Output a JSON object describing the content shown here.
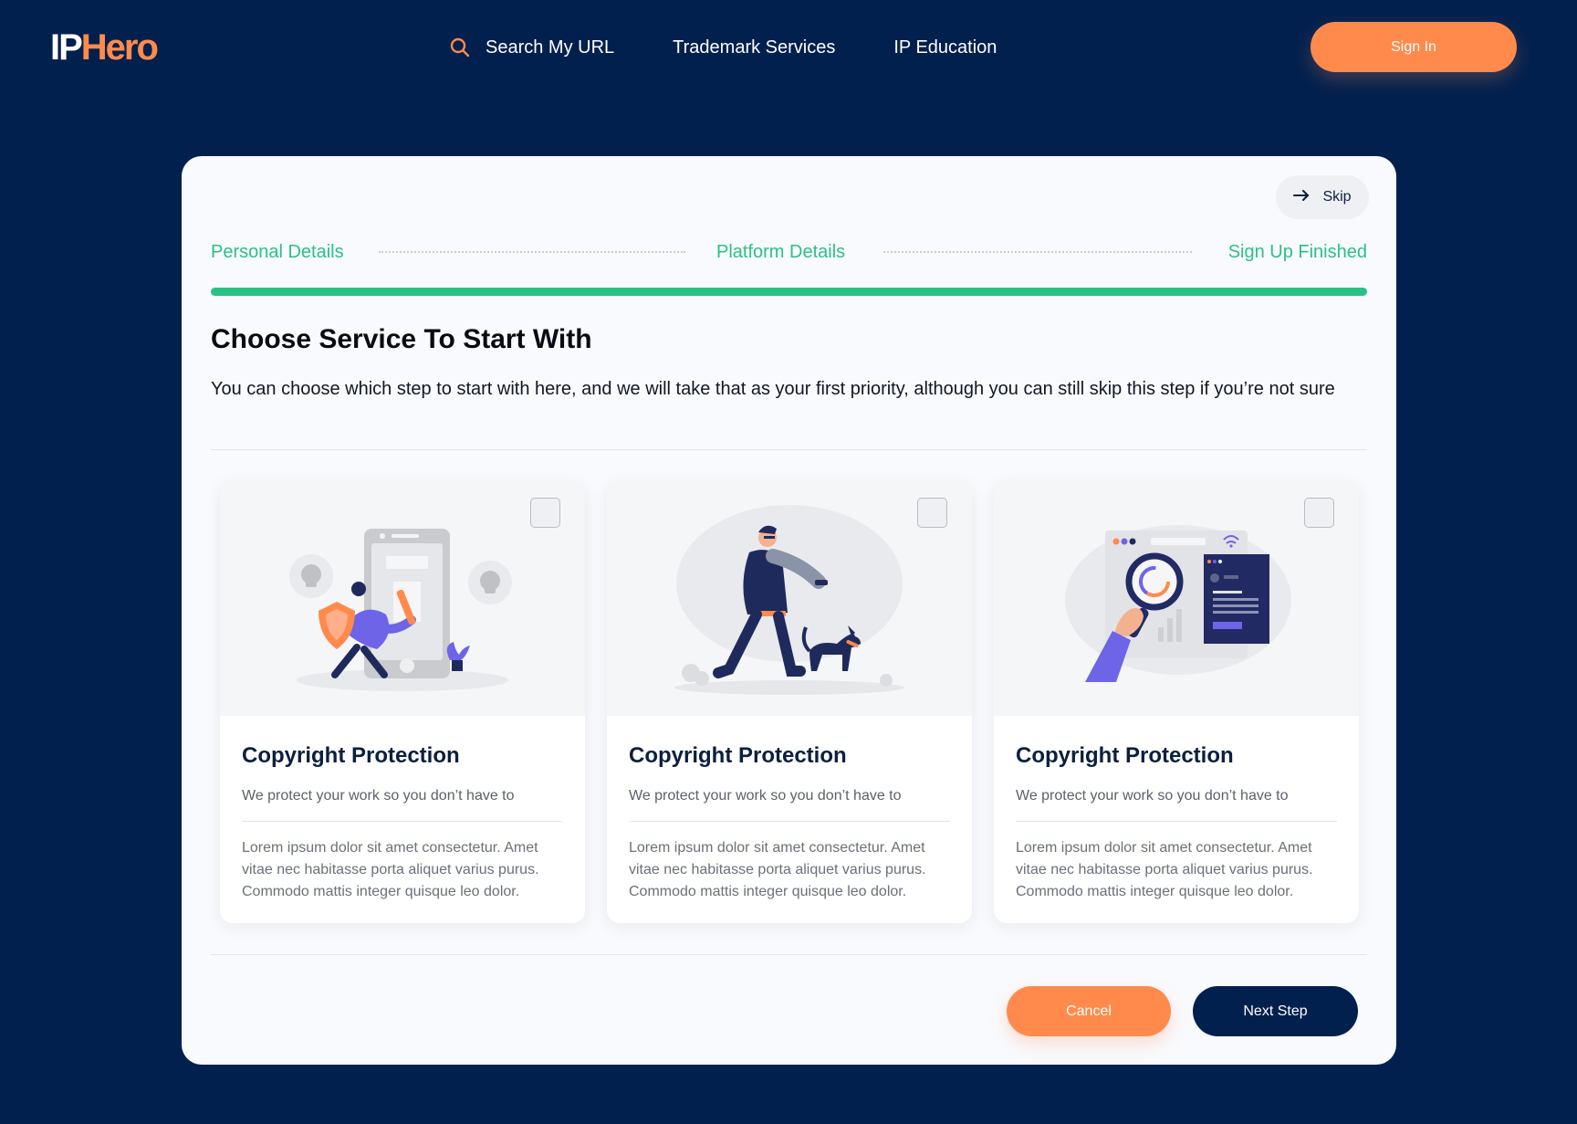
{
  "brand": {
    "logo_part1": "IP",
    "logo_part2": "Hero"
  },
  "nav": {
    "items": [
      {
        "label": "Search My URL",
        "icon": "search-icon"
      },
      {
        "label": "Trademark Services"
      },
      {
        "label": "IP Education"
      }
    ],
    "signin_label": "Sign In"
  },
  "onboarding": {
    "skip_label": "Skip",
    "steps": [
      "Personal Details",
      "Platform Details",
      "Sign Up Finished"
    ],
    "progress": 1.0,
    "title": "Choose Service To Start With",
    "description": "You can choose which step to start with here, and we will take that as your first priority, although you can still skip this step if you’re not sure",
    "cards": [
      {
        "title": "Copyright Protection",
        "subtitle": "We protect your work so you don’t have to",
        "body": "Lorem ipsum dolor sit amet consectetur. Amet vitae nec habitasse porta aliquet varius purus. Commodo mattis integer quisque leo dolor.",
        "illustration": "phone-shield-illustration",
        "checked": false
      },
      {
        "title": "Copyright Protection",
        "subtitle": "We protect your work so you don’t have to",
        "body": "Lorem ipsum dolor sit amet consectetur. Amet vitae nec habitasse porta aliquet varius purus. Commodo mattis integer quisque leo dolor.",
        "illustration": "guard-dog-illustration",
        "checked": false
      },
      {
        "title": "Copyright Protection",
        "subtitle": "We protect your work so you don’t have to",
        "body": "Lorem ipsum dolor sit amet consectetur. Amet vitae nec habitasse porta aliquet varius purus. Commodo mattis integer quisque leo dolor.",
        "illustration": "magnifier-analytics-illustration",
        "checked": false
      }
    ],
    "cancel_label": "Cancel",
    "next_label": "Next Step"
  },
  "colors": {
    "background": "#02204e",
    "accent": "#ff8a4c",
    "success": "#2ac184",
    "panel": "#f9fafd"
  }
}
